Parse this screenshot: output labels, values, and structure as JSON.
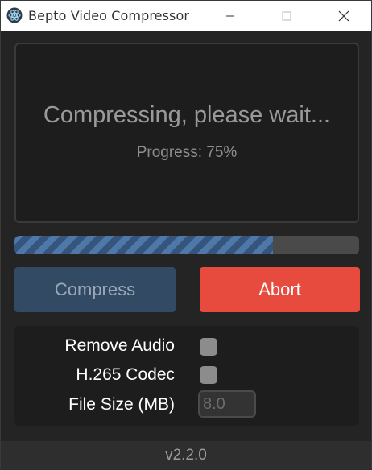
{
  "window": {
    "title": "Bepto Video Compressor",
    "app_icon": "electron-atom-icon",
    "controls": {
      "minimize": "minimize-icon",
      "maximize": "maximize-icon",
      "close": "close-icon"
    }
  },
  "status": {
    "message": "Compressing, please wait...",
    "progress_text": "Progress: 75%"
  },
  "progress": {
    "value": 0.75,
    "fill_color": "#4e78a8",
    "track_color": "#4a4a4a"
  },
  "actions": {
    "compress_label": "Compress",
    "abort_label": "Abort",
    "compress_color": "#324a63",
    "abort_color": "#e64b3e"
  },
  "options": {
    "remove_audio_label": "Remove Audio",
    "remove_audio_checked": false,
    "h265_label": "H.265 Codec",
    "h265_checked": false,
    "file_size_label": "File Size (MB)",
    "file_size_placeholder": "8.0"
  },
  "footer": {
    "version": "v2.2.0"
  }
}
